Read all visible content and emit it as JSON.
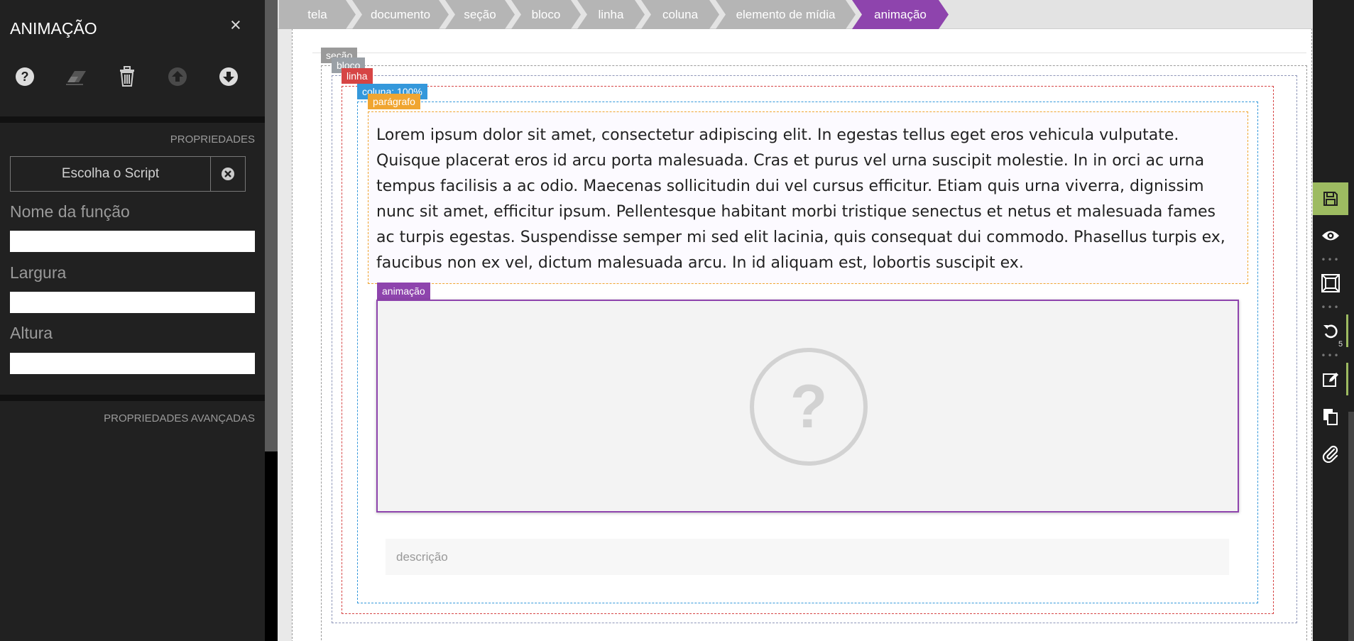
{
  "panel": {
    "title": "ANIMAÇÃO",
    "close_icon": "×",
    "toolbar": [
      "help-icon",
      "eraser-icon",
      "trash-icon",
      "move-up-icon",
      "move-down-icon"
    ],
    "properties_heading": "PROPRIEDADES",
    "script_button_label": "Escolha o Script",
    "fields": [
      {
        "label": "Nome da função",
        "value": ""
      },
      {
        "label": "Largura",
        "value": ""
      },
      {
        "label": "Altura",
        "value": ""
      }
    ],
    "advanced_heading": "PROPRIEDADES AVANÇADAS"
  },
  "breadcrumb": [
    {
      "label": "tela",
      "color": "#b5b5b5"
    },
    {
      "label": "documento",
      "color": "#b5b5b5"
    },
    {
      "label": "seção",
      "color": "#b5b5b5"
    },
    {
      "label": "bloco",
      "color": "#b5b5b5"
    },
    {
      "label": "linha",
      "color": "#b5b5b5"
    },
    {
      "label": "coluna",
      "color": "#b5b5b5"
    },
    {
      "label": "elemento de mídia",
      "color": "#b5b5b5"
    },
    {
      "label": "animação",
      "color": "#8e44ad"
    }
  ],
  "tags": {
    "secao": "seção",
    "bloco": "bloco",
    "linha": "linha",
    "coluna": "coluna: 100%",
    "paragrafo": "parágrafo",
    "animacao": "animação"
  },
  "colors": {
    "secao": "#9a9a9a",
    "bloco": "#8e96b8",
    "linha": "#d64545",
    "coluna": "#3498db",
    "paragrafo": "#f0a530",
    "animacao": "#8e44ad"
  },
  "paragraph": "Lorem ipsum dolor sit amet, consectetur adipiscing elit. In egestas tellus eget eros vehicula vulputate. Quisque placerat eros id arcu porta malesuada. Cras et purus vel urna suscipit molestie. In in orci ac urna tempus facilisis a ac odio. Maecenas sollicitudin dui vel cursus efficitur. Etiam quis urna viverra, dignissim nunc sit amet, efficitur ipsum. Pellentesque habitant morbi tristique senectus et netus et malesuada fames ac turpis egestas. Suspendisse semper mi sed elit lacinia, quis consequat dui commodo. Phasellus turpis ex, faucibus non ex vel, dictum malesuada arcu. In id aliquam est, lobortis suscipit ex.",
  "animation_placeholder": "?",
  "description_placeholder": "descrição",
  "right_toolbar": {
    "buttons": [
      "save-icon",
      "preview-icon",
      "fit-screen-icon",
      "undo-icon",
      "edit-icon",
      "copy-icon",
      "attach-icon"
    ],
    "undo_count": "5"
  }
}
